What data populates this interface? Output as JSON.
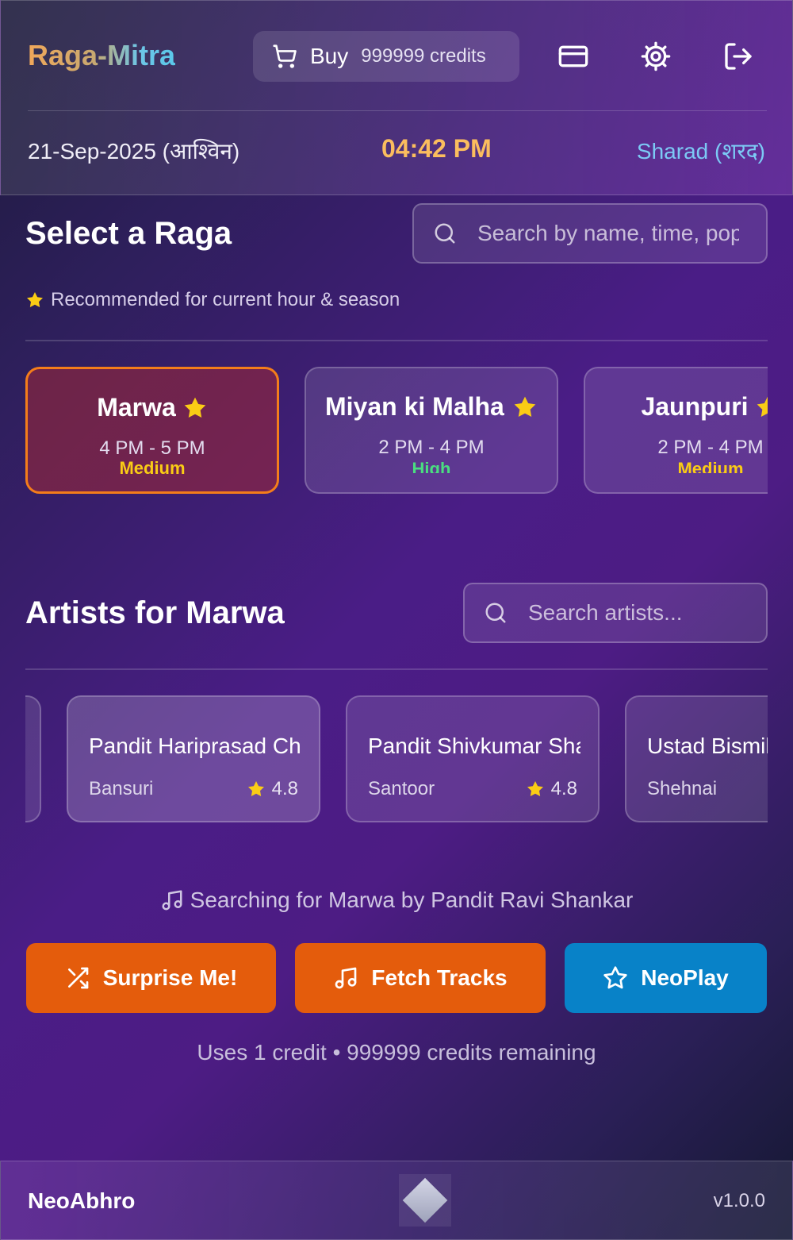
{
  "header": {
    "app_name": "Raga-Mitra",
    "buy_label": "Buy",
    "buy_credits": "999999 credits",
    "icons": [
      "shopping-cart-icon",
      "credit-card-icon",
      "settings-gear-icon",
      "logout-icon"
    ],
    "date": "21-Sep-2025 (आश्विन)",
    "time": "04:42 PM",
    "season": "Sharad (शरद)"
  },
  "raga_section": {
    "title": "Select a Raga",
    "search_placeholder": "Search by name, time, popularity...",
    "recommended_note": "Recommended for current hour & season",
    "ragas": [
      {
        "name": "Marwa",
        "time": "4 PM - 5 PM",
        "popularity": "Medium",
        "recommended": true,
        "selected": true
      },
      {
        "name": "Miyan ki Malhar",
        "time": "2 PM - 4 PM",
        "popularity": "High",
        "recommended": true,
        "selected": false
      },
      {
        "name": "Jaunpuri",
        "time": "2 PM - 4 PM",
        "popularity": "Medium",
        "recommended": true,
        "selected": false
      }
    ]
  },
  "artist_section": {
    "title": "Artists for Marwa",
    "search_placeholder": "Search artists...",
    "artists": [
      {
        "name": "Pandit Hariprasad Chaurasia",
        "instrument": "Bansuri",
        "rating": "4.8"
      },
      {
        "name": "Pandit Shivkumar Sharma",
        "instrument": "Santoor",
        "rating": "4.8"
      },
      {
        "name": "Ustad Bismillah Khan",
        "instrument": "Shehnai",
        "rating": ""
      }
    ]
  },
  "status": {
    "searching": "Searching for Marwa by Pandit Ravi Shankar"
  },
  "actions": {
    "surprise": "Surprise Me!",
    "fetch": "Fetch Tracks",
    "neoplay": "NeoPlay",
    "credit_note": "Uses 1 credit • 999999 credits remaining"
  },
  "footer": {
    "brand": "NeoAbhro",
    "version": "v1.0.0"
  },
  "colors": {
    "accent_orange": "#e45c0c",
    "accent_blue": "#0882c8",
    "time_gold": "#fbbd5e",
    "season_blue": "#7ccaf5",
    "popularity_medium": "#facc15",
    "popularity_high": "#4ade80",
    "star": "#facc15"
  }
}
